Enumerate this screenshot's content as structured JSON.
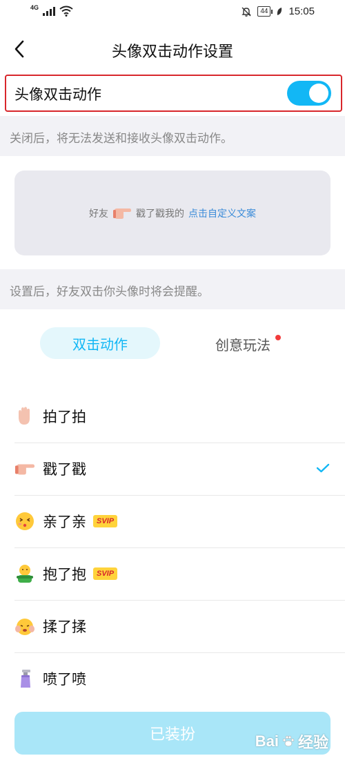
{
  "status_bar": {
    "network": "4G",
    "battery": "44",
    "time": "15:05",
    "icons": [
      "signal-icon",
      "wifi-icon",
      "bell-off-icon",
      "battery-icon",
      "leaf-icon"
    ]
  },
  "header": {
    "title": "头像双击动作设置",
    "back_icon": "chevron-left-icon"
  },
  "toggle_row": {
    "label": "头像双击动作",
    "enabled": true,
    "accent_color": "#12b7f5"
  },
  "toggle_hint": "关闭后，将无法发送和接收头像双击动作。",
  "preview": {
    "friend": "好友",
    "action": "戳了戳我的",
    "link": "点击自定义文案",
    "link_color": "#3a8bd8",
    "icon": "pointing-hand-icon"
  },
  "preview_hint": "设置后，好友双击你头像时将会提醒。",
  "tabs": [
    {
      "label": "双击动作",
      "active": true
    },
    {
      "label": "创意玩法",
      "active": false,
      "has_dot": true
    }
  ],
  "actions": [
    {
      "label": "拍了拍",
      "icon": "waving-hand-icon",
      "svip": false,
      "selected": false
    },
    {
      "label": "戳了戳",
      "icon": "pointing-hand-icon",
      "svip": false,
      "selected": true
    },
    {
      "label": "亲了亲",
      "icon": "kissing-face-icon",
      "svip": true,
      "selected": false
    },
    {
      "label": "抱了抱",
      "icon": "hugging-figure-icon",
      "svip": true,
      "selected": false
    },
    {
      "label": "揉了揉",
      "icon": "rubbed-face-icon",
      "svip": false,
      "selected": false
    },
    {
      "label": "喷了喷",
      "icon": "spray-bottle-icon",
      "svip": false,
      "selected": false
    }
  ],
  "svip_badge": "SVIP",
  "equip_button": "已装扮",
  "watermark": {
    "text": "Bai",
    "suffix": "经验"
  }
}
